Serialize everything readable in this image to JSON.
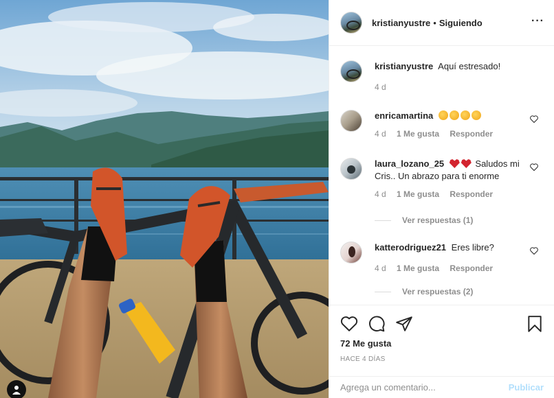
{
  "header": {
    "username": "kristianyustre",
    "separator": "•",
    "follow_status": "Siguiendo",
    "more_icon": "more-horizontal-icon"
  },
  "caption": {
    "username": "kristianyustre",
    "text": "Aquí estresado!",
    "time": "4 d"
  },
  "comments": [
    {
      "username": "enricamartina",
      "text": "",
      "emoji": [
        "clapping-hands",
        "clapping-hands",
        "clapping-hands",
        "clapping-hands"
      ],
      "time": "4 d",
      "likes": "1 Me gusta",
      "reply": "Responder"
    },
    {
      "username": "laura_lozano_25",
      "text": "Saludos mi Cris.. Un abrazo para ti enorme",
      "emoji": [
        "heart",
        "heart"
      ],
      "time": "4 d",
      "likes": "1 Me gusta",
      "reply": "Responder",
      "view_replies": "Ver respuestas (1)"
    },
    {
      "username": "katterodriguez21",
      "text": "Eres libre?",
      "emoji": [],
      "time": "4 d",
      "likes": "1 Me gusta",
      "reply": "Responder",
      "view_replies": "Ver respuestas (2)"
    }
  ],
  "actions": {
    "icons": [
      "heart-icon",
      "comment-icon",
      "share-icon",
      "bookmark-icon"
    ],
    "likes": "72 Me gusta",
    "posted_ago": "HACE 4 DÍAS"
  },
  "add_comment": {
    "placeholder": "Agrega un comentario...",
    "post_label": "Publicar",
    "post_color": "#b2dffc"
  }
}
